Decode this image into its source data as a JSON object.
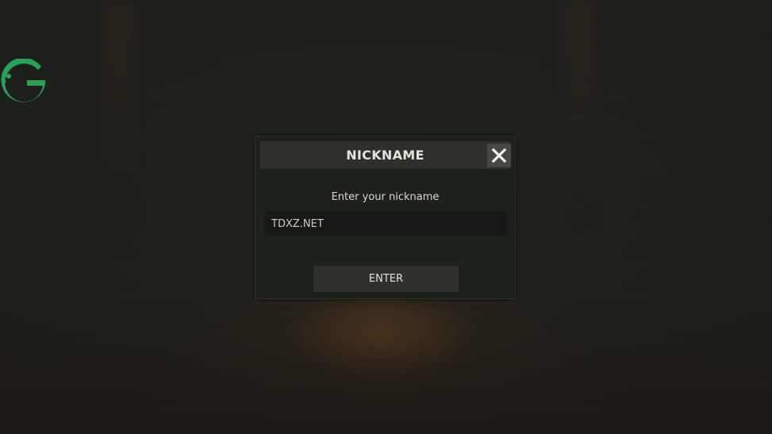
{
  "dialog": {
    "title": "NICKNAME",
    "prompt": "Enter your nickname",
    "nickname_value": "TDXZ.NET",
    "enter_label": "ENTER",
    "close_icon": "close-icon"
  },
  "logo": {
    "icon": "g-logo-icon",
    "color": "#2ca05a"
  },
  "colors": {
    "dialog_bg": "#1d211c",
    "header_bg": "#2f302b",
    "close_bg": "#474743",
    "input_bg": "#161916",
    "button_bg": "#30312c",
    "text": "#e6e2d8"
  }
}
